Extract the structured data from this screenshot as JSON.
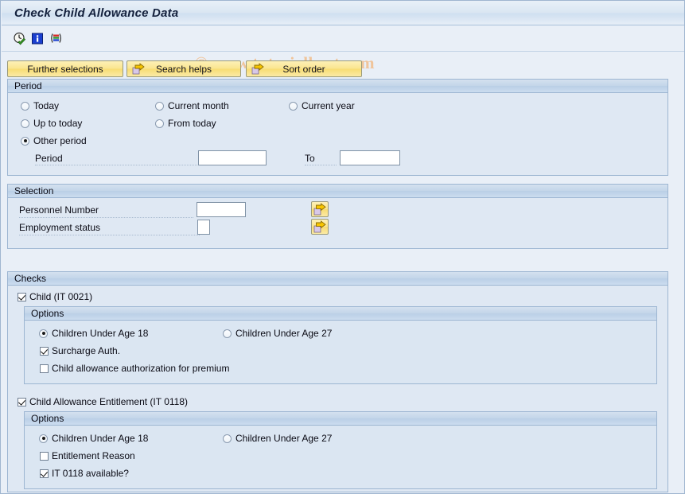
{
  "window": {
    "title": "Check Child Allowance Data"
  },
  "watermark": {
    "text": "© www.tutorialkart.com"
  },
  "toolbar": {
    "icons": [
      {
        "name": "execute-clock-icon",
        "title": "Execute with variant"
      },
      {
        "name": "info-icon",
        "title": "Information"
      },
      {
        "name": "variant-list-icon",
        "title": "Get variant"
      }
    ]
  },
  "buttons": {
    "further_selections": "Further selections",
    "search_helps": "Search helps",
    "sort_order": "Sort order"
  },
  "period": {
    "header": "Period",
    "options": [
      {
        "label": "Today",
        "selected": false
      },
      {
        "label": "Current month",
        "selected": false
      },
      {
        "label": "Current year",
        "selected": false
      },
      {
        "label": "Up to today",
        "selected": false
      },
      {
        "label": "From today",
        "selected": false
      },
      {
        "label": "Other period",
        "selected": true
      }
    ],
    "period_label": "Period",
    "period_value": "",
    "to_label": "To",
    "to_value": ""
  },
  "selection": {
    "header": "Selection",
    "personnel_number_label": "Personnel Number",
    "personnel_number_value": "",
    "employment_status_label": "Employment status",
    "employment_status_value": "",
    "multi_select_icon": "multi-selection-arrow-icon"
  },
  "checks": {
    "header": "Checks",
    "groups": [
      {
        "checkbox_label": "Child (IT 0021)",
        "checked": true,
        "options_header": "Options",
        "radios": [
          {
            "label": "Children Under Age 18",
            "selected": true
          },
          {
            "label": "Children Under Age 27",
            "selected": false
          }
        ],
        "checkboxes": [
          {
            "label": "Surcharge Auth.",
            "checked": true
          },
          {
            "label": "Child allowance authorization for premium",
            "checked": false
          }
        ]
      },
      {
        "checkbox_label": "Child Allowance Entitlement (IT 0118)",
        "checked": true,
        "options_header": "Options",
        "radios": [
          {
            "label": "Children Under Age 18",
            "selected": true
          },
          {
            "label": "Children Under Age 27",
            "selected": false
          }
        ],
        "checkboxes": [
          {
            "label": "Entitlement Reason",
            "checked": false
          },
          {
            "label": "IT 0118 available?",
            "checked": true
          }
        ]
      }
    ]
  },
  "colors": {
    "window_background": "#e9eff7",
    "panel_background": "#dfe8f3",
    "panel_header": "#c3d5e9",
    "button_yellow": "#fae58e",
    "title_text": "#14213d",
    "watermark": "#f0c49a"
  }
}
